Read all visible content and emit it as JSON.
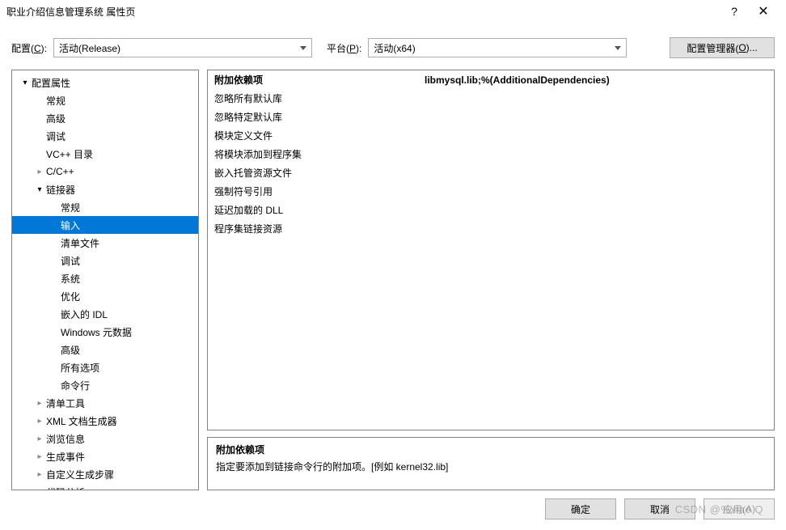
{
  "window": {
    "title": "职业介绍信息管理系统 属性页",
    "help": "?",
    "close": "✕"
  },
  "topbar": {
    "config_label_pre": "配置(",
    "config_label_u": "C",
    "config_label_post": "):",
    "config_value": "活动(Release)",
    "platform_label_pre": "平台(",
    "platform_label_u": "P",
    "platform_label_post": "):",
    "platform_value": "活动(x64)",
    "manager_btn_pre": "配置管理器(",
    "manager_btn_u": "O",
    "manager_btn_post": ")..."
  },
  "tree": [
    {
      "label": "配置属性",
      "depth": 0,
      "expand": "open"
    },
    {
      "label": "常规",
      "depth": 1,
      "expand": "none"
    },
    {
      "label": "高级",
      "depth": 1,
      "expand": "none"
    },
    {
      "label": "调试",
      "depth": 1,
      "expand": "none"
    },
    {
      "label": "VC++ 目录",
      "depth": 1,
      "expand": "none"
    },
    {
      "label": "C/C++",
      "depth": 1,
      "expand": "closed"
    },
    {
      "label": "链接器",
      "depth": 1,
      "expand": "open"
    },
    {
      "label": "常规",
      "depth": 2,
      "expand": "none"
    },
    {
      "label": "输入",
      "depth": 2,
      "expand": "none",
      "selected": true
    },
    {
      "label": "清单文件",
      "depth": 2,
      "expand": "none"
    },
    {
      "label": "调试",
      "depth": 2,
      "expand": "none"
    },
    {
      "label": "系统",
      "depth": 2,
      "expand": "none"
    },
    {
      "label": "优化",
      "depth": 2,
      "expand": "none"
    },
    {
      "label": "嵌入的 IDL",
      "depth": 2,
      "expand": "none"
    },
    {
      "label": "Windows 元数据",
      "depth": 2,
      "expand": "none"
    },
    {
      "label": "高级",
      "depth": 2,
      "expand": "none"
    },
    {
      "label": "所有选项",
      "depth": 2,
      "expand": "none"
    },
    {
      "label": "命令行",
      "depth": 2,
      "expand": "none"
    },
    {
      "label": "清单工具",
      "depth": 1,
      "expand": "closed"
    },
    {
      "label": "XML 文档生成器",
      "depth": 1,
      "expand": "closed"
    },
    {
      "label": "浏览信息",
      "depth": 1,
      "expand": "closed"
    },
    {
      "label": "生成事件",
      "depth": 1,
      "expand": "closed"
    },
    {
      "label": "自定义生成步骤",
      "depth": 1,
      "expand": "closed"
    },
    {
      "label": "代码分析",
      "depth": 1,
      "expand": "closed"
    }
  ],
  "grid": [
    {
      "name": "附加依赖项",
      "value": "libmysql.lib;%(AdditionalDependencies)",
      "active": true
    },
    {
      "name": "忽略所有默认库",
      "value": ""
    },
    {
      "name": "忽略特定默认库",
      "value": ""
    },
    {
      "name": "模块定义文件",
      "value": ""
    },
    {
      "name": "将模块添加到程序集",
      "value": ""
    },
    {
      "name": "嵌入托管资源文件",
      "value": ""
    },
    {
      "name": "强制符号引用",
      "value": ""
    },
    {
      "name": "延迟加载的 DLL",
      "value": ""
    },
    {
      "name": "程序集链接资源",
      "value": ""
    }
  ],
  "desc": {
    "title": "附加依赖项",
    "text": "指定要添加到链接命令行的附加项。[例如 kernel32.lib]"
  },
  "footer": {
    "ok": "确定",
    "cancel": "取消",
    "apply_pre": "应用(",
    "apply_u": "A",
    "apply_post": ")"
  },
  "watermark": "CSDN @%xiao Q"
}
